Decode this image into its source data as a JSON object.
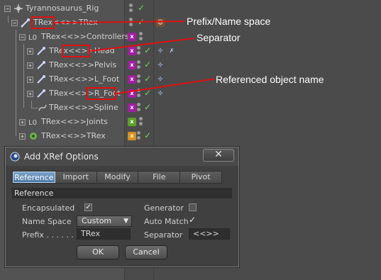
{
  "outliner": {
    "rows": [
      {
        "label": "Tyrannosaurus_Rig"
      },
      {
        "label": "TRex<<>>TRex"
      },
      {
        "label": "TRex<<>>Controllers"
      },
      {
        "label": "TRex<<>>Head"
      },
      {
        "label": "TRex<<>>Pelvis"
      },
      {
        "label": "TRex<<>>L_Foot"
      },
      {
        "label": "TRex<<>>R_Foot"
      },
      {
        "label": "TRex<<>>Spline"
      },
      {
        "label": "TRex<<>>Joints"
      },
      {
        "label": "TRex<<>>TRex"
      }
    ]
  },
  "annotations": {
    "prefix": "Prefix/Name space",
    "separator": "Separator",
    "referenced": "Referenced object name"
  },
  "dialog": {
    "title": "Add XRef Options",
    "close_glyph": "✕",
    "tabs": [
      {
        "label": "Reference",
        "active": true
      },
      {
        "label": "Import"
      },
      {
        "label": "Modify"
      },
      {
        "label": "File"
      },
      {
        "label": "Pivot"
      }
    ],
    "section": "Reference",
    "encapsulated_label": "Encapsulated",
    "encapsulated_checked": true,
    "generator_label": "Generator",
    "generator_checked": false,
    "namespace_label": "Name Space",
    "namespace_value": "Custom",
    "automatch_label": "Auto Match",
    "automatch_checked": true,
    "prefix_label": "Prefix . . . . . .",
    "prefix_value": "TRex",
    "separator_label": "Separator",
    "separator_value": "<<>>",
    "ok_label": "OK",
    "cancel_label": "Cancel"
  },
  "colors": {
    "background": "#4b4b4b",
    "accent_red": "#e01010",
    "check_green": "#6fd35a",
    "tag_purple": "#a020a0",
    "tag_green": "#5aa02a",
    "tag_orange": "#d89020"
  },
  "icons": {
    "expander": "expand-box-icon",
    "null_object": "null-object-icon",
    "bone": "bone-icon",
    "visibility": "visibility-dots-icon",
    "enabled": "checkmark-icon",
    "xpresso": "xpresso-tag-icon"
  }
}
